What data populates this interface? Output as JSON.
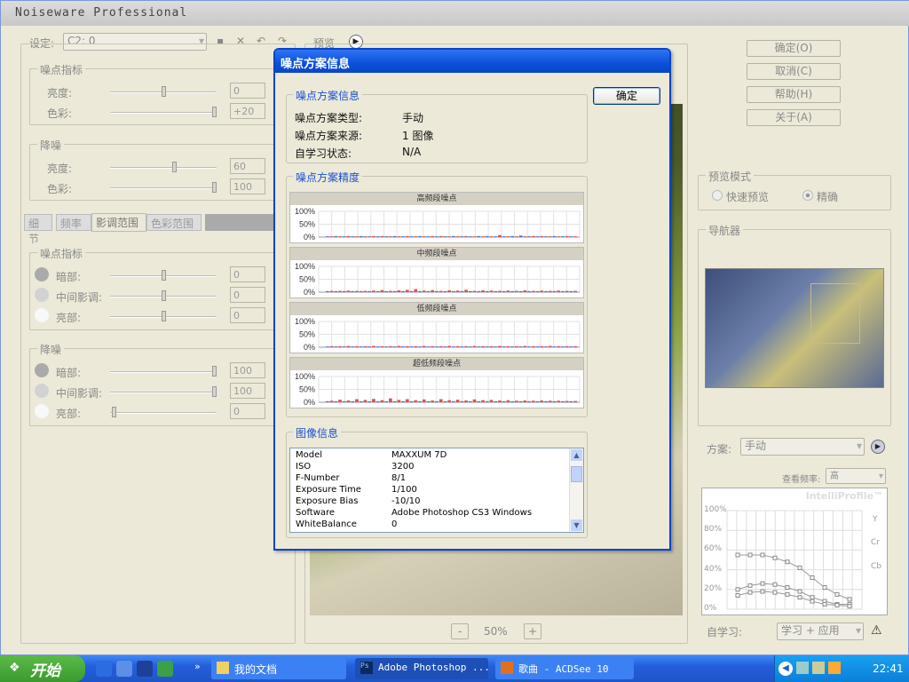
{
  "app": {
    "title": "Noiseware Professional"
  },
  "left": {
    "preset_label": "设定:",
    "preset_value": "C2: 0",
    "preview_label": "预览",
    "noise_level": {
      "title": "噪点指标",
      "brightness": "亮度:",
      "brightness_val": "0",
      "color": "色彩:",
      "color_val": "+20"
    },
    "noise_reduction": {
      "title": "降噪",
      "brightness": "亮度:",
      "brightness_val": "60",
      "color": "色彩:",
      "color_val": "100"
    },
    "tabs": [
      "细节",
      "频率",
      "影调范围",
      "色彩范围"
    ],
    "tone_level": {
      "title": "噪点指标",
      "dark": "暗部:",
      "dark_val": "0",
      "mid": "中间影调:",
      "mid_val": "0",
      "light": "亮部:",
      "light_val": "0"
    },
    "tone_reduction": {
      "title": "降噪",
      "dark": "暗部:",
      "dark_val": "100",
      "mid": "中间影调:",
      "mid_val": "100",
      "light": "亮部:",
      "light_val": "0"
    }
  },
  "right": {
    "ok": "确定(O)",
    "cancel": "取消(C)",
    "help": "帮助(H)",
    "about": "关于(A)",
    "preview_mode": {
      "title": "预览模式",
      "fast": "快速预览",
      "accurate": "精确"
    },
    "navigator": "导航器",
    "profile_label": "方案:",
    "profile_value": "手动",
    "freq_label": "查看频率:",
    "freq_value": "高",
    "intelli": "IntelliProfile™",
    "y_ticks": [
      "100%",
      "80%",
      "60%",
      "40%",
      "20%",
      "0%"
    ],
    "channels": [
      "Y",
      "Cr",
      "Cb"
    ],
    "self_learn_label": "自学习:",
    "self_learn_value": "学习 + 应用"
  },
  "zoom": {
    "minus": "-",
    "value": "50%",
    "plus": "+"
  },
  "dialog": {
    "title": "噪点方案信息",
    "ok": "确定",
    "info_group": "噪点方案信息",
    "rows": [
      {
        "label": "噪点方案类型:",
        "value": "手动"
      },
      {
        "label": "噪点方案来源:",
        "value": "1 图像"
      },
      {
        "label": "自学习状态:",
        "value": "N/A"
      }
    ],
    "precision_group": "噪点方案精度",
    "image_group": "图像信息",
    "exif": [
      {
        "k": "Model",
        "v": "MAXXUM 7D"
      },
      {
        "k": "ISO",
        "v": "3200"
      },
      {
        "k": "F-Number",
        "v": "8/1"
      },
      {
        "k": "Exposure Time",
        "v": "1/100"
      },
      {
        "k": "Exposure Bias",
        "v": "-10/10"
      },
      {
        "k": "Software",
        "v": "Adobe Photoshop CS3 Windows"
      },
      {
        "k": "WhiteBalance",
        "v": "0"
      }
    ]
  },
  "chart_data": [
    {
      "type": "bar",
      "title": "高频段噪点",
      "y_ticks": [
        "100%",
        "50%",
        "0%"
      ],
      "ylim": [
        0,
        100
      ],
      "colors": [
        "#4a6fe0",
        "#e05050"
      ],
      "values": [
        3,
        3,
        4,
        3,
        3,
        4,
        3,
        3,
        4,
        3,
        3,
        4,
        3,
        4,
        3,
        3,
        4,
        3,
        3,
        4,
        3,
        3,
        4,
        3,
        3,
        4,
        3,
        4,
        3,
        3,
        4,
        3,
        3,
        4,
        3,
        3,
        4,
        3,
        4,
        3,
        3,
        8,
        3,
        3,
        4,
        3,
        6,
        3,
        3,
        4,
        3,
        4,
        3,
        3,
        4,
        3,
        3,
        4,
        3,
        3
      ]
    },
    {
      "type": "bar",
      "title": "中频段噪点",
      "y_ticks": [
        "100%",
        "50%",
        "0%"
      ],
      "ylim": [
        0,
        100
      ],
      "colors": [
        "#4a6fe0",
        "#e05050"
      ],
      "values": [
        4,
        5,
        4,
        5,
        4,
        6,
        4,
        5,
        4,
        5,
        4,
        6,
        4,
        8,
        4,
        5,
        4,
        7,
        4,
        9,
        4,
        12,
        4,
        6,
        4,
        8,
        4,
        5,
        4,
        7,
        4,
        6,
        4,
        9,
        4,
        5,
        4,
        7,
        4,
        6,
        4,
        5,
        4,
        6,
        4,
        5,
        4,
        7,
        4,
        5,
        4,
        6,
        4,
        5,
        4,
        6,
        4,
        5,
        4,
        5
      ]
    },
    {
      "type": "bar",
      "title": "低频段噪点",
      "y_ticks": [
        "100%",
        "50%",
        "0%"
      ],
      "ylim": [
        0,
        100
      ],
      "colors": [
        "#4a6fe0",
        "#e05050"
      ],
      "values": [
        3,
        4,
        3,
        4,
        3,
        5,
        3,
        4,
        3,
        4,
        3,
        5,
        3,
        4,
        3,
        4,
        3,
        5,
        3,
        4,
        3,
        4,
        3,
        5,
        3,
        4,
        3,
        4,
        3,
        5,
        3,
        4,
        3,
        4,
        3,
        5,
        3,
        4,
        3,
        4,
        3,
        5,
        3,
        4,
        3,
        4,
        3,
        5,
        3,
        4,
        3,
        4,
        3,
        5,
        3,
        4,
        3,
        4,
        3,
        4
      ]
    },
    {
      "type": "bar",
      "title": "超低频段噪点",
      "y_ticks": [
        "100%",
        "50%",
        "0%"
      ],
      "ylim": [
        0,
        100
      ],
      "colors": [
        "#4a6fe0",
        "#e05050"
      ],
      "values": [
        4,
        6,
        4,
        10,
        4,
        7,
        4,
        12,
        4,
        9,
        4,
        13,
        4,
        8,
        4,
        15,
        4,
        9,
        4,
        12,
        4,
        8,
        4,
        11,
        4,
        7,
        4,
        12,
        4,
        8,
        4,
        10,
        4,
        7,
        4,
        11,
        4,
        8,
        4,
        9,
        4,
        7,
        4,
        8,
        4,
        6,
        4,
        7,
        4,
        6,
        4,
        7,
        4,
        6,
        4,
        6,
        4,
        5,
        4,
        5
      ]
    }
  ],
  "taskbar": {
    "start": "开始",
    "items": [
      "我的文档",
      "Adobe Photoshop ...",
      "歌曲 - ACDSee 10"
    ],
    "clock": "22:41"
  }
}
